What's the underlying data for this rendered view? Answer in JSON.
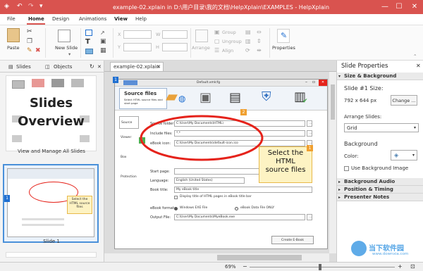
{
  "titlebar": {
    "title": "example-02.xplain in D:\\用户目录\\我的文档\\HelpXplain\\EXAMPLES - HelpXplain",
    "minimize": "—",
    "maximize": "☐",
    "close": "✕"
  },
  "menu": {
    "tabs": [
      "File",
      "Home",
      "Design",
      "Animations",
      "View",
      "Help"
    ]
  },
  "ribbon": {
    "paste": "Paste",
    "new_slide": "New Slide",
    "x": "X",
    "y": "Y",
    "w": "W",
    "h": "H",
    "group": "Group",
    "ungroup": "Ungroup",
    "arrange": "Arrange",
    "align": "Align",
    "properties": "Properties"
  },
  "left_panel": {
    "tabs": [
      "Slides",
      "Objects"
    ],
    "slide1_line1": "Slides",
    "slide1_line2": "Overview",
    "slide1_caption": "View and Manage All Slides",
    "slide2_caption": "Slide 1",
    "slide2_number": "1",
    "thumb_callout": "Select the HTML source files"
  },
  "document": {
    "tab": "example-02.xplain",
    "tab_close": "✕"
  },
  "canvas": {
    "badge1": "1",
    "badge2": "2",
    "badge_mini": "1",
    "win_title": "Default.xmlcfg",
    "header_title": "Source files",
    "header_sub": "Select HTML source files and start page",
    "sidebar": [
      "Source",
      "Viewer",
      "Box",
      "Protection"
    ],
    "fields": [
      {
        "label": "Source folder:",
        "value": "C:\\User\\My Documents\\HTML\\"
      },
      {
        "label": "Include files:",
        "value": "*.*"
      },
      {
        "label": "eBook icon:",
        "value": "C:\\User\\My Documents\\default-icon.ico"
      }
    ],
    "start_page_label": "Start page:",
    "language_label": "Language:",
    "language_value": "English (United States)",
    "ebook_title_label": "Book title:",
    "ebook_title_value": "My eBook title",
    "checkbox_label": "Display title of HTML pages in eBook title bar",
    "format_label": "eBook format:",
    "format_opt1": "Windows EXE File",
    "format_opt2": "eBook Data File ONLY",
    "output_label": "Output File:",
    "output_value": "C:\\User\\My Documents\\MyeBook.exe",
    "create_button": "Create E-Book",
    "callout": {
      "line1": "Select the",
      "line2": "HTML",
      "line3": "source files"
    }
  },
  "right_panel": {
    "title": "Slide Properties",
    "section_size": "Size & Background",
    "slide_size_label": "Slide #1 Size:",
    "slide_size_value": "792 x 644 px",
    "change_button": "Change ...",
    "arrange_label": "Arrange Slides:",
    "arrange_value": "Grid",
    "background_label": "Background",
    "color_label": "Color:",
    "use_bg_image": "Use Background Image",
    "sections": [
      "Background Audio",
      "Position & Timing",
      "Presenter Notes"
    ]
  },
  "statusbar": {
    "zoom": "69%"
  },
  "watermark": {
    "cn": "当下软件园",
    "en": "www.downxia.com"
  },
  "colors": {
    "accent": "#d9534f",
    "callout_fill": "#fdf3c3",
    "callout_border": "#e8b94a",
    "ellipse": "#e5231b",
    "blue_badge": "#1f6fd1",
    "orange_badge": "#f0a030",
    "green_badge": "#4caf50"
  }
}
